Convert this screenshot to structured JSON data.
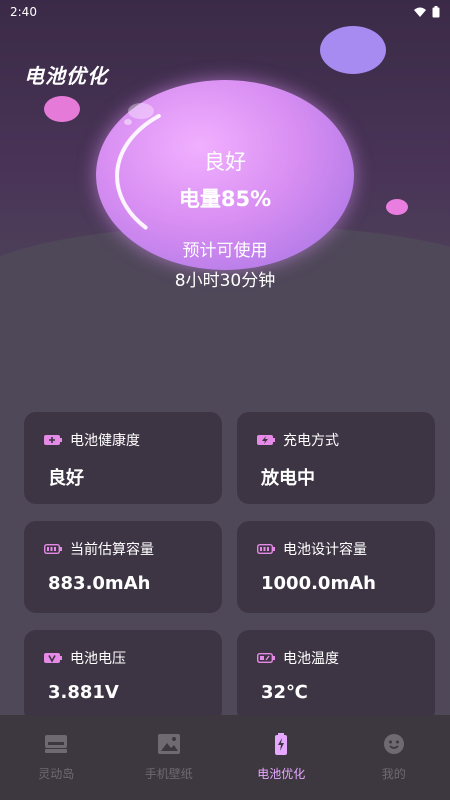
{
  "status_bar": {
    "time": "2:40"
  },
  "app": {
    "title": "电池优化"
  },
  "battery": {
    "health": "良好",
    "level_label": "电量85%",
    "level": 0.85,
    "estimate_label": "预计可使用",
    "estimate_time": "8小时30分钟"
  },
  "cards": [
    {
      "label": "电池健康度",
      "value": "良好",
      "icon": "battery-plus-icon"
    },
    {
      "label": "充电方式",
      "value": "放电中",
      "icon": "battery-bolt-icon"
    },
    {
      "label": "当前估算容量",
      "value": "883.0mAh",
      "icon": "battery-bars-icon"
    },
    {
      "label": "电池设计容量",
      "value": "1000.0mAh",
      "icon": "battery-bars-icon"
    },
    {
      "label": "电池电压",
      "value": "3.881V",
      "icon": "battery-voltage-icon"
    },
    {
      "label": "电池温度",
      "value": "32℃",
      "icon": "battery-temp-icon"
    }
  ],
  "nav": {
    "items": [
      {
        "label": "灵动岛",
        "icon": "dynamic-island-icon",
        "active": false
      },
      {
        "label": "手机壁纸",
        "icon": "wallpaper-icon",
        "active": false
      },
      {
        "label": "电池优化",
        "icon": "battery-icon",
        "active": true
      },
      {
        "label": "我的",
        "icon": "smiley-icon",
        "active": false
      }
    ]
  },
  "colors": {
    "accent": "#e7a8ff",
    "icon_pink": "#e58ae6",
    "card_bg": "#3e3544",
    "page_bg": "#4f4859"
  }
}
